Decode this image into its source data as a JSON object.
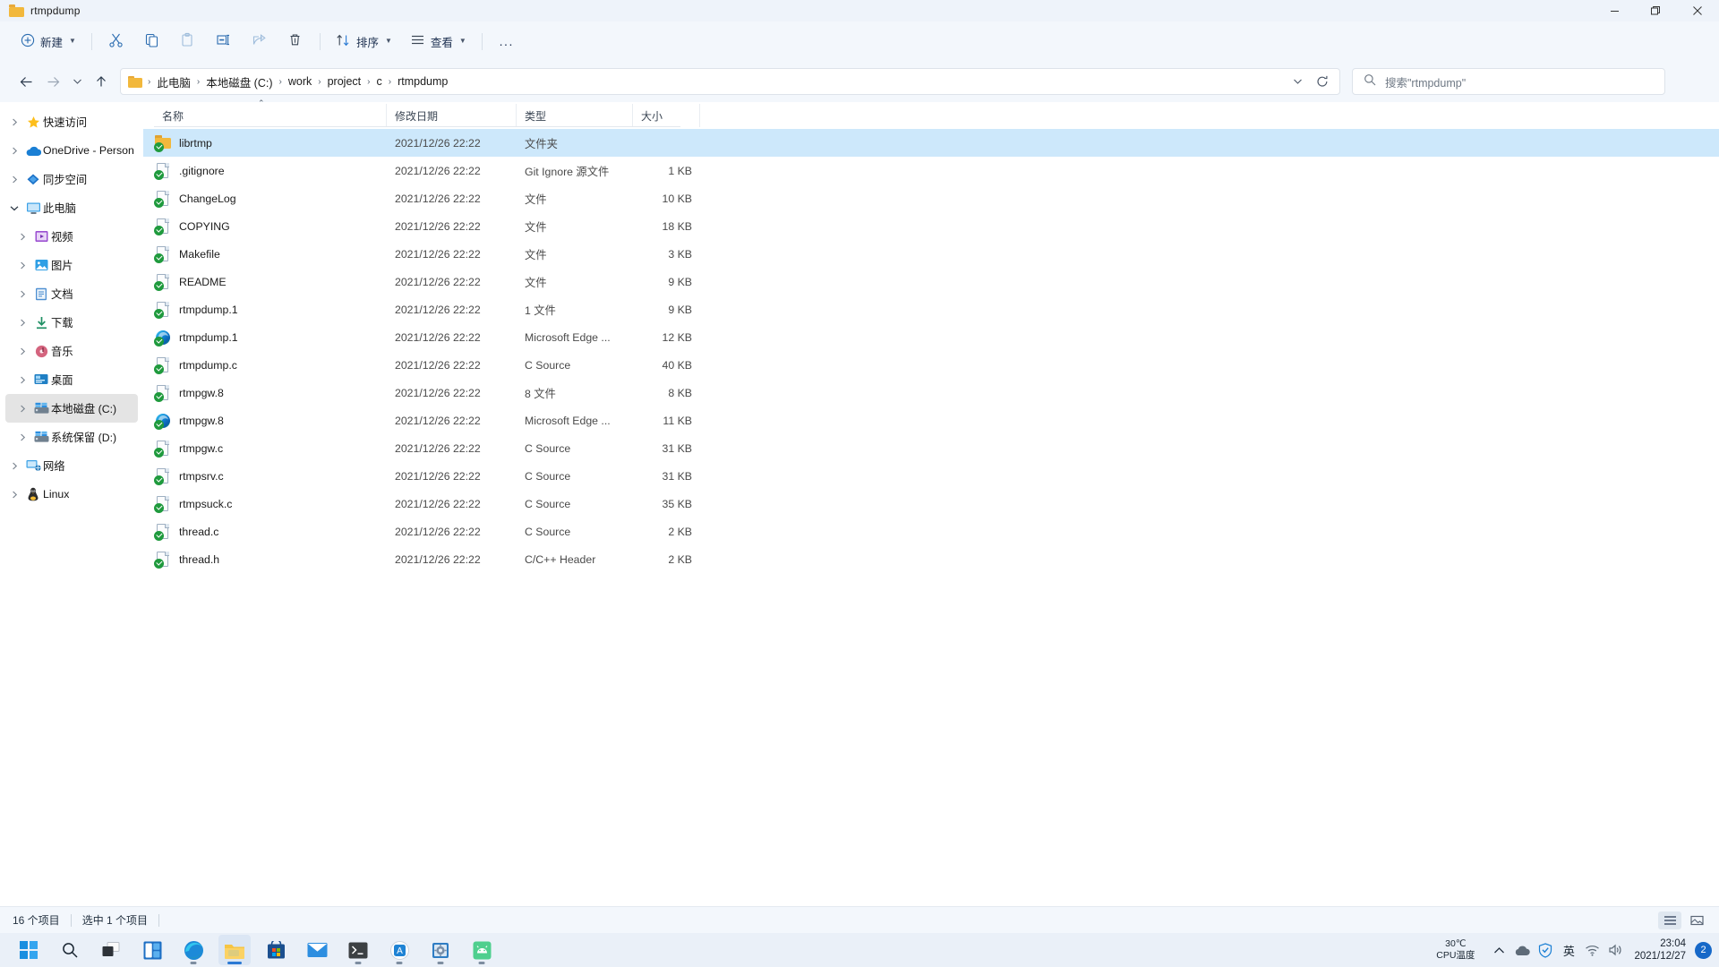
{
  "window": {
    "title": "rtmpdump",
    "minimize": "─",
    "maximize": "❐",
    "close": "✕"
  },
  "toolbar": {
    "new_label": "新建",
    "cut_label": "剪切",
    "copy_label": "复制",
    "paste_label": "粘贴",
    "rename_label": "重命名",
    "share_label": "共享",
    "delete_label": "删除",
    "sort_label": "排序",
    "view_label": "查看",
    "more_label": "..."
  },
  "address": {
    "back": "←",
    "forward": "→",
    "recent": "⌄",
    "up": "↑",
    "crumbs": [
      "此电脑",
      "本地磁盘 (C:)",
      "work",
      "project",
      "c",
      "rtmpdump"
    ],
    "separator": "›",
    "dropdown": "⌄",
    "refresh": "↻"
  },
  "search": {
    "placeholder": "搜索\"rtmpdump\"",
    "icon": "search-icon"
  },
  "sidebar": {
    "items": [
      {
        "label": "快速访问",
        "icon": "star-icon",
        "arrow": "collapsed",
        "indent": 0,
        "selected": false
      },
      {
        "label": "OneDrive - Person",
        "icon": "cloud-icon",
        "arrow": "collapsed",
        "indent": 0,
        "selected": false
      },
      {
        "label": "同步空间",
        "icon": "sync-icon",
        "arrow": "collapsed",
        "indent": 0,
        "selected": false
      },
      {
        "label": "此电脑",
        "icon": "computer-icon",
        "arrow": "expanded",
        "indent": 0,
        "selected": false
      },
      {
        "label": "视频",
        "icon": "video-icon",
        "arrow": "collapsed",
        "indent": 1,
        "selected": false
      },
      {
        "label": "图片",
        "icon": "pictures-icon",
        "arrow": "collapsed",
        "indent": 1,
        "selected": false
      },
      {
        "label": "文档",
        "icon": "documents-icon",
        "arrow": "collapsed",
        "indent": 1,
        "selected": false
      },
      {
        "label": "下载",
        "icon": "downloads-icon",
        "arrow": "collapsed",
        "indent": 1,
        "selected": false
      },
      {
        "label": "音乐",
        "icon": "music-icon",
        "arrow": "collapsed",
        "indent": 1,
        "selected": false
      },
      {
        "label": "桌面",
        "icon": "desktop-icon",
        "arrow": "collapsed",
        "indent": 1,
        "selected": false
      },
      {
        "label": "本地磁盘 (C:)",
        "icon": "drive-icon",
        "arrow": "collapsed",
        "indent": 1,
        "selected": true
      },
      {
        "label": "系统保留 (D:)",
        "icon": "drive-icon",
        "arrow": "collapsed",
        "indent": 1,
        "selected": false
      },
      {
        "label": "网络",
        "icon": "network-icon",
        "arrow": "collapsed",
        "indent": 0,
        "selected": false
      },
      {
        "label": "Linux",
        "icon": "linux-icon",
        "arrow": "collapsed",
        "indent": 0,
        "selected": false
      }
    ]
  },
  "filelist": {
    "columns": [
      "名称",
      "修改日期",
      "类型",
      "大小"
    ],
    "sort_indicator": "⌃",
    "rows": [
      {
        "name": "librtmp",
        "date": "2021/12/26 22:22",
        "type": "文件夹",
        "size": "",
        "icon": "folder-git-icon",
        "selected": true
      },
      {
        "name": ".gitignore",
        "date": "2021/12/26 22:22",
        "type": "Git Ignore 源文件",
        "size": "1 KB",
        "icon": "file-git-icon",
        "selected": false
      },
      {
        "name": "ChangeLog",
        "date": "2021/12/26 22:22",
        "type": "文件",
        "size": "10 KB",
        "icon": "file-git-icon",
        "selected": false
      },
      {
        "name": "COPYING",
        "date": "2021/12/26 22:22",
        "type": "文件",
        "size": "18 KB",
        "icon": "file-git-icon",
        "selected": false
      },
      {
        "name": "Makefile",
        "date": "2021/12/26 22:22",
        "type": "文件",
        "size": "3 KB",
        "icon": "file-git-icon",
        "selected": false
      },
      {
        "name": "README",
        "date": "2021/12/26 22:22",
        "type": "文件",
        "size": "9 KB",
        "icon": "file-git-icon",
        "selected": false
      },
      {
        "name": "rtmpdump.1",
        "date": "2021/12/26 22:22",
        "type": "1 文件",
        "size": "9 KB",
        "icon": "file-git-icon",
        "selected": false
      },
      {
        "name": "rtmpdump.1",
        "date": "2021/12/26 22:22",
        "type": "Microsoft Edge ...",
        "size": "12 KB",
        "icon": "edge-icon",
        "selected": false
      },
      {
        "name": "rtmpdump.c",
        "date": "2021/12/26 22:22",
        "type": "C Source",
        "size": "40 KB",
        "icon": "file-git-icon",
        "selected": false
      },
      {
        "name": "rtmpgw.8",
        "date": "2021/12/26 22:22",
        "type": "8 文件",
        "size": "8 KB",
        "icon": "file-git-icon",
        "selected": false
      },
      {
        "name": "rtmpgw.8",
        "date": "2021/12/26 22:22",
        "type": "Microsoft Edge ...",
        "size": "11 KB",
        "icon": "edge-icon",
        "selected": false
      },
      {
        "name": "rtmpgw.c",
        "date": "2021/12/26 22:22",
        "type": "C Source",
        "size": "31 KB",
        "icon": "file-git-icon",
        "selected": false
      },
      {
        "name": "rtmpsrv.c",
        "date": "2021/12/26 22:22",
        "type": "C Source",
        "size": "31 KB",
        "icon": "file-git-icon",
        "selected": false
      },
      {
        "name": "rtmpsuck.c",
        "date": "2021/12/26 22:22",
        "type": "C Source",
        "size": "35 KB",
        "icon": "file-git-icon",
        "selected": false
      },
      {
        "name": "thread.c",
        "date": "2021/12/26 22:22",
        "type": "C Source",
        "size": "2 KB",
        "icon": "file-git-icon",
        "selected": false
      },
      {
        "name": "thread.h",
        "date": "2021/12/26 22:22",
        "type": "C/C++ Header",
        "size": "2 KB",
        "icon": "file-git-icon",
        "selected": false
      }
    ]
  },
  "status": {
    "item_count": "16 个项目",
    "selection": "选中 1 个项目"
  },
  "taskbar": {
    "items": [
      {
        "name": "start-button",
        "running": false,
        "active": false
      },
      {
        "name": "search-button",
        "running": false,
        "active": false
      },
      {
        "name": "task-view-button",
        "running": false,
        "active": false
      },
      {
        "name": "widgets-button",
        "running": false,
        "active": false
      },
      {
        "name": "edge-button",
        "running": true,
        "active": false
      },
      {
        "name": "file-explorer-button",
        "running": true,
        "active": true
      },
      {
        "name": "microsoft-store-button",
        "running": false,
        "active": false
      },
      {
        "name": "mail-button",
        "running": false,
        "active": false
      },
      {
        "name": "terminal-button",
        "running": true,
        "active": false
      },
      {
        "name": "app-button",
        "running": true,
        "active": false
      },
      {
        "name": "settings-app-button",
        "running": true,
        "active": false
      },
      {
        "name": "android-app-button",
        "running": true,
        "active": false
      }
    ],
    "tray": {
      "cpu_temp": "30℃",
      "cpu_label": "CPU温度",
      "overflow": "∧",
      "ime": "英",
      "time": "23:04",
      "date": "2021/12/27",
      "notification_count": "2"
    }
  },
  "colors": {
    "accent": "#1668c8",
    "selection": "#cde8fb",
    "chrome": "#f3f7fc",
    "folder": "#f2b83c"
  }
}
